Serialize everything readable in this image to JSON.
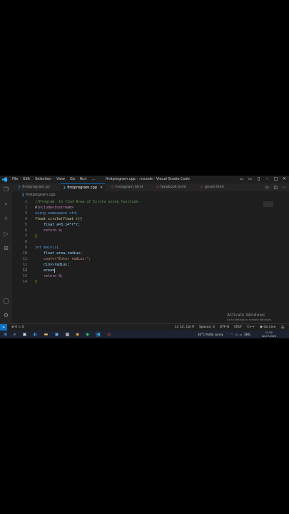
{
  "window": {
    "title": "firstprogram.cpp - .vscode - Visual Studio Code",
    "menu": [
      "File",
      "Edit",
      "Selection",
      "View",
      "Go",
      "Run",
      "…"
    ]
  },
  "tabs": [
    {
      "label": "firstprogram.py",
      "icon": "python-icon",
      "active": false
    },
    {
      "label": "firstprogram.cpp",
      "icon": "cpp-icon",
      "active": true
    },
    {
      "label": "instagram.html",
      "icon": "html-icon",
      "active": false
    },
    {
      "label": "facebook.html",
      "icon": "html-icon",
      "active": false
    },
    {
      "label": "gmail.html",
      "icon": "html-icon",
      "active": false
    }
  ],
  "breadcrumb": "firstprogram.cpp",
  "code_lines": [
    {
      "n": "1",
      "text": "//Program  to find Area of Circle using function."
    },
    {
      "n": "2",
      "text": "#include<iostream>"
    },
    {
      "n": "3",
      "text": "using namespace std;"
    },
    {
      "n": "4",
      "text": "float circle(float r){"
    },
    {
      "n": "5",
      "text": "    float a=3.14*r*r;"
    },
    {
      "n": "6",
      "text": "    return a;"
    },
    {
      "n": "7",
      "text": "}"
    },
    {
      "n": "8",
      "text": ""
    },
    {
      "n": "9",
      "text": "int main(){"
    },
    {
      "n": "10",
      "text": "    float area,radius;"
    },
    {
      "n": "11",
      "text": "    cout<<\"Enter radius:\";"
    },
    {
      "n": "11",
      "text": "    cin>>radius;"
    },
    {
      "n": "12",
      "text": "    area="
    },
    {
      "n": "13",
      "text": "    return 0;"
    },
    {
      "n": "14",
      "text": "}"
    }
  ],
  "watermark": {
    "line1": "Activate Windows",
    "line2": "Go to Settings to activate Windows."
  },
  "status": {
    "errors": "⊗ 0 ⚠ 0",
    "position": "Ln 12, Col 9",
    "spaces": "Spaces: 3",
    "encoding": "UTF-8",
    "eol": "CRLF",
    "language": "C++",
    "golive": "Go Live"
  },
  "taskbar": {
    "weather": "30°C  Partly sunny",
    "lang": "ENG",
    "time": "11:52",
    "date": "02-07-2023"
  },
  "colors": {
    "accent": "#0e70c0",
    "background": "#1e1e1e"
  }
}
